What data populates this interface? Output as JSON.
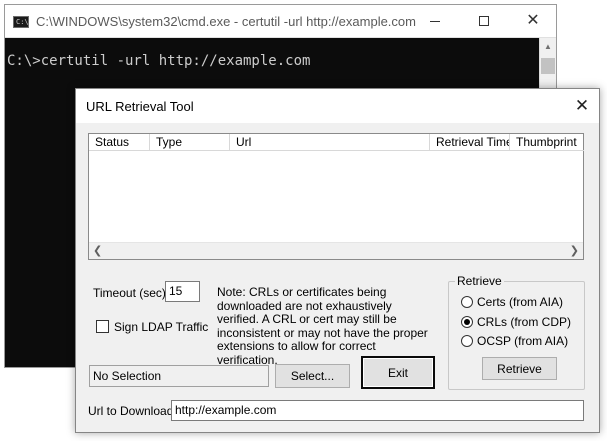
{
  "cmd": {
    "title": "C:\\WINDOWS\\system32\\cmd.exe - certutil  -url http://example.com",
    "icon_label": "C:\\",
    "prompt_line": "C:\\>certutil -url http://example.com"
  },
  "dialog": {
    "title": "URL Retrieval Tool",
    "columns": [
      "Status",
      "Type",
      "Url",
      "Retrieval Time",
      "Thumbprint"
    ],
    "timeout_label": "Timeout (sec)",
    "timeout_value": "15",
    "sign_ldap_label": "Sign LDAP Traffic",
    "sign_ldap_checked": false,
    "note_text": "Note: CRLs or certificates being downloaded are not exhaustively verified.  A CRL or cert may still be inconsistent or may not have the proper extensions to allow for correct verification.",
    "retrieve_group": {
      "title": "Retrieve",
      "options": [
        {
          "label": "Certs (from AIA)",
          "checked": false
        },
        {
          "label": "CRLs (from CDP)",
          "checked": true
        },
        {
          "label": "OCSP (from AIA)",
          "checked": false
        }
      ],
      "button_label": "Retrieve"
    },
    "selection_text": "No Selection",
    "select_button_label": "Select...",
    "exit_button_label": "Exit",
    "url_label": "Url to Download",
    "url_value": "http://example.com"
  }
}
